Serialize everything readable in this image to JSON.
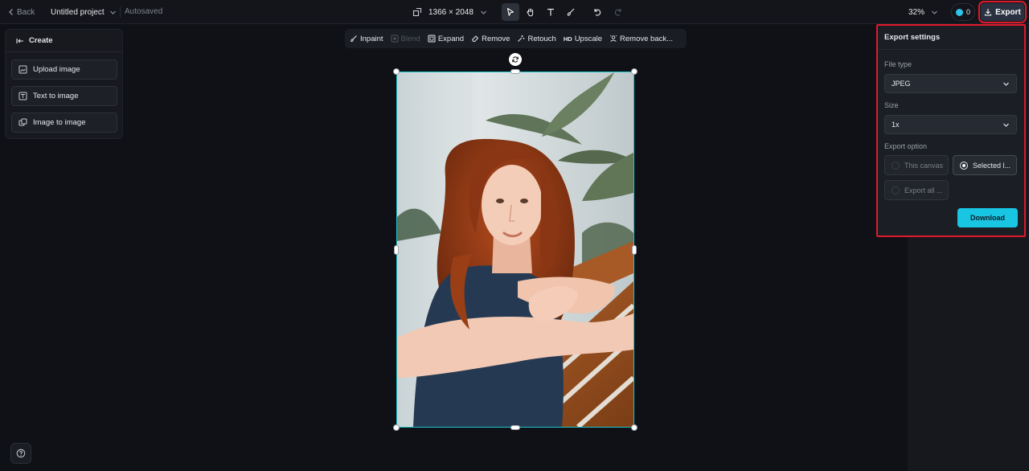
{
  "topbar": {
    "back_label": "Back",
    "project_title": "Untitled project",
    "autosave_status": "Autosaved",
    "canvas_size": "1366 × 2048",
    "zoom": "32%",
    "credits": "0",
    "export_label": "Export"
  },
  "create_panel": {
    "title": "Create",
    "items": [
      {
        "label": "Upload image",
        "icon": "upload-image-icon"
      },
      {
        "label": "Text to image",
        "icon": "text-to-image-icon"
      },
      {
        "label": "Image to image",
        "icon": "image-to-image-icon"
      }
    ]
  },
  "edit_toolbar": {
    "inpaint": "Inpaint",
    "blend": "Blend",
    "expand": "Expand",
    "remove": "Remove",
    "retouch": "Retouch",
    "upscale_badge": "HD",
    "upscale": "Upscale",
    "remove_background": "Remove back..."
  },
  "export_settings": {
    "title": "Export settings",
    "file_type_label": "File type",
    "file_type_value": "JPEG",
    "size_label": "Size",
    "size_value": "1x",
    "option_label": "Export option",
    "options": [
      {
        "label": "This canvas",
        "selected": false
      },
      {
        "label": "Selected l...",
        "selected": true
      },
      {
        "label": "Export all ...",
        "selected": false
      }
    ],
    "download_label": "Download"
  },
  "colors": {
    "accent": "#18c6e4",
    "selection": "#1fc6c9",
    "highlight": "#e0192b",
    "background": "#0f1116"
  }
}
